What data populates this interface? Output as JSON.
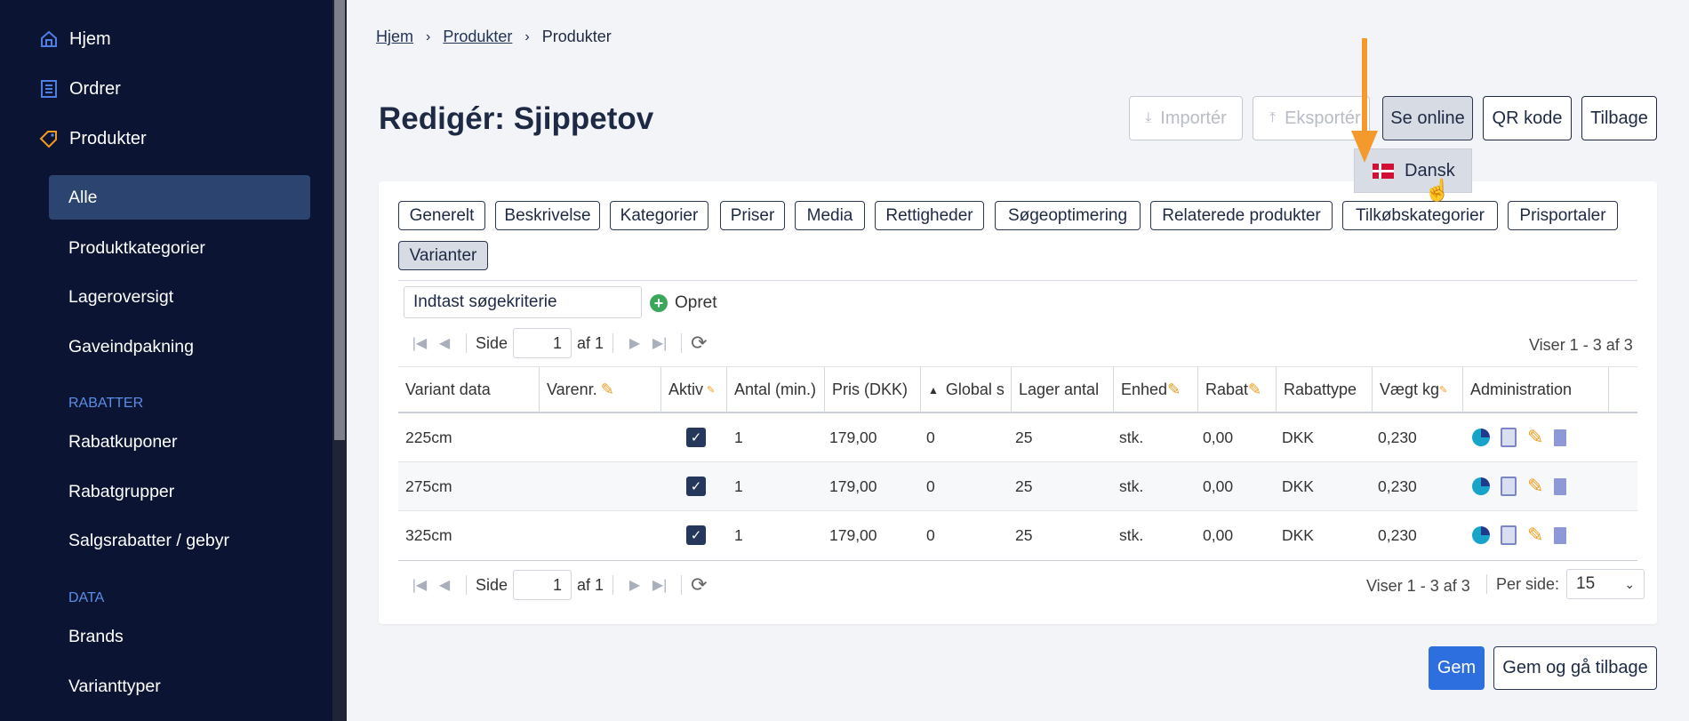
{
  "sidebar": {
    "top_items": [
      {
        "label": "Hjem",
        "icon": "home-icon"
      },
      {
        "label": "Ordrer",
        "icon": "orders-icon"
      },
      {
        "label": "Produkter",
        "icon": "tag-icon"
      }
    ],
    "product_items": [
      "Alle",
      "Produktkategorier",
      "Lageroversigt",
      "Gaveindpakning"
    ],
    "section_rabatter": "RABATTER",
    "rabatter_items": [
      "Rabatkuponer",
      "Rabatgrupper",
      "Salgsrabatter / gebyr"
    ],
    "section_data": "DATA",
    "data_items": [
      "Brands",
      "Varianttyper"
    ]
  },
  "breadcrumb": [
    "Hjem",
    "Produkter",
    "Produkter"
  ],
  "page_title": "Redigér: Sjippetov",
  "actions": {
    "import": "Importér",
    "export": "Eksportér",
    "see_online": "Se online",
    "qr": "QR kode",
    "back": "Tilbage"
  },
  "dropdown": {
    "language": "Dansk"
  },
  "tabs": [
    "Generelt",
    "Beskrivelse",
    "Kategorier",
    "Priser",
    "Media",
    "Rettigheder",
    "Søgeoptimering",
    "Relaterede produkter",
    "Tilkøbskategorier",
    "Prisportaler",
    "Varianter"
  ],
  "search": {
    "placeholder": "Indtast søgekriterie"
  },
  "opret": "Opret",
  "pager": {
    "side": "Side",
    "page": "1",
    "of": "af 1",
    "showing": "Viser 1 - 3 af 3",
    "per_page_label": "Per side:",
    "per_page": "15"
  },
  "table": {
    "headers": [
      "Variant data",
      "Varenr.",
      "Aktiv",
      "Antal (min.)",
      "Pris (DKK)",
      "Global s",
      "Lager antal",
      "Enhed",
      "Rabat",
      "Rabattype",
      "Vægt kg",
      "Administration"
    ],
    "rows": [
      {
        "variant": "225cm",
        "varenr": "",
        "active": true,
        "antal": "1",
        "pris": "179,00",
        "global": "0",
        "lager": "25",
        "enhed": "stk.",
        "rabat": "0,00",
        "rabattype": "DKK",
        "vaegt": "0,230"
      },
      {
        "variant": "275cm",
        "varenr": "",
        "active": true,
        "antal": "1",
        "pris": "179,00",
        "global": "0",
        "lager": "25",
        "enhed": "stk.",
        "rabat": "0,00",
        "rabattype": "DKK",
        "vaegt": "0,230"
      },
      {
        "variant": "325cm",
        "varenr": "",
        "active": true,
        "antal": "1",
        "pris": "179,00",
        "global": "0",
        "lager": "25",
        "enhed": "stk.",
        "rabat": "0,00",
        "rabattype": "DKK",
        "vaegt": "0,230"
      }
    ]
  },
  "footer": {
    "save": "Gem",
    "save_back": "Gem og gå tilbage"
  },
  "colors": {
    "sidebar": "#0c1433",
    "primary": "#2e6fe0",
    "accent_arrow": "#f49a2c"
  }
}
